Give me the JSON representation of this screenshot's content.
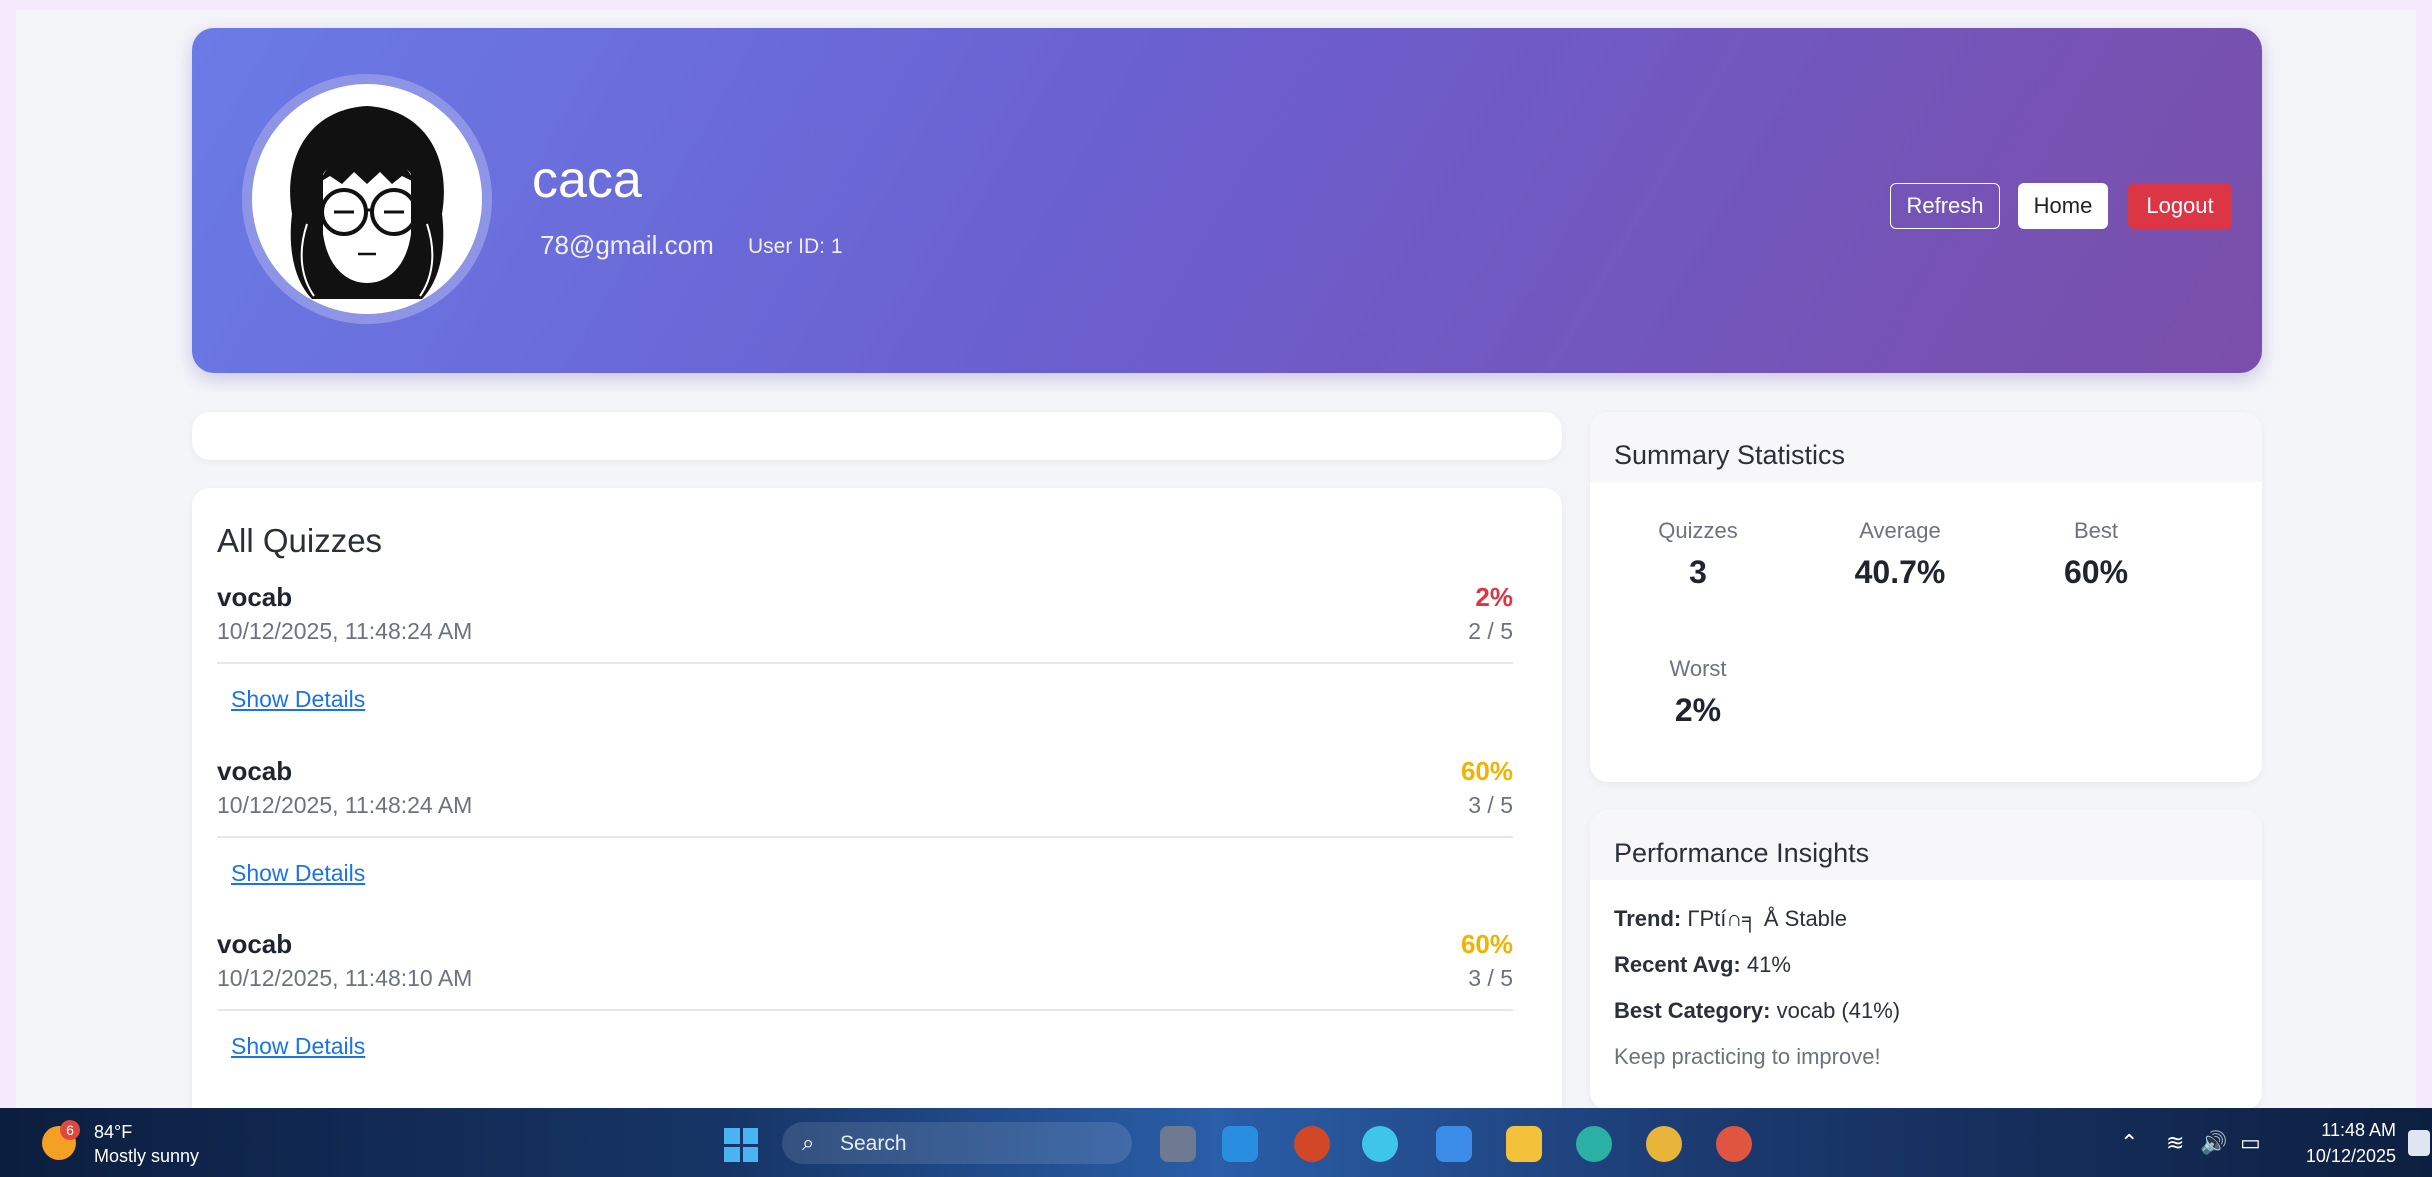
{
  "profile": {
    "username": "caca",
    "email": "78@gmail.com",
    "user_id": "User ID: 1"
  },
  "header_buttons": {
    "refresh": "Refresh",
    "home": "Home",
    "logout": "Logout"
  },
  "quizzes": {
    "title": "All Quizzes",
    "items": [
      {
        "name": "vocab",
        "date": "10/12/2025, 11:48:24 AM",
        "score": "2%",
        "count": "2 / 5",
        "link": "Show Details",
        "color": "#dc3545"
      },
      {
        "name": "vocab",
        "date": "10/12/2025, 11:48:24 AM",
        "score": "60%",
        "count": "3 / 5",
        "link": "Show Details",
        "color": "#f0b400"
      },
      {
        "name": "vocab",
        "date": "10/12/2025, 11:48:10 AM",
        "score": "60%",
        "count": "3 / 5",
        "link": "Show Details",
        "color": "#f0b400"
      }
    ]
  },
  "summary": {
    "title": "Summary Statistics",
    "quizzes_label": "Quizzes",
    "quizzes_value": "3",
    "average_label": "Average",
    "average_value": "40.7%",
    "best_label": "Best",
    "best_value": "60%",
    "worst_label": "Worst",
    "worst_value": "2%"
  },
  "insights": {
    "title": "Performance Insights",
    "trend_label": "Trend:",
    "trend_value": " ΓPtí∩╕ Å Stable",
    "recent_label": "Recent Avg:",
    "recent_value": " 41%",
    "best_cat_label": "Best Category:",
    "best_cat_value": " vocab (41%)",
    "note": "Keep practicing to improve!"
  },
  "taskbar": {
    "weather_badge": "6",
    "temperature": "84°F",
    "weather": "Mostly sunny",
    "search": "Search",
    "time": "11:48 AM",
    "date": "10/12/2025"
  }
}
